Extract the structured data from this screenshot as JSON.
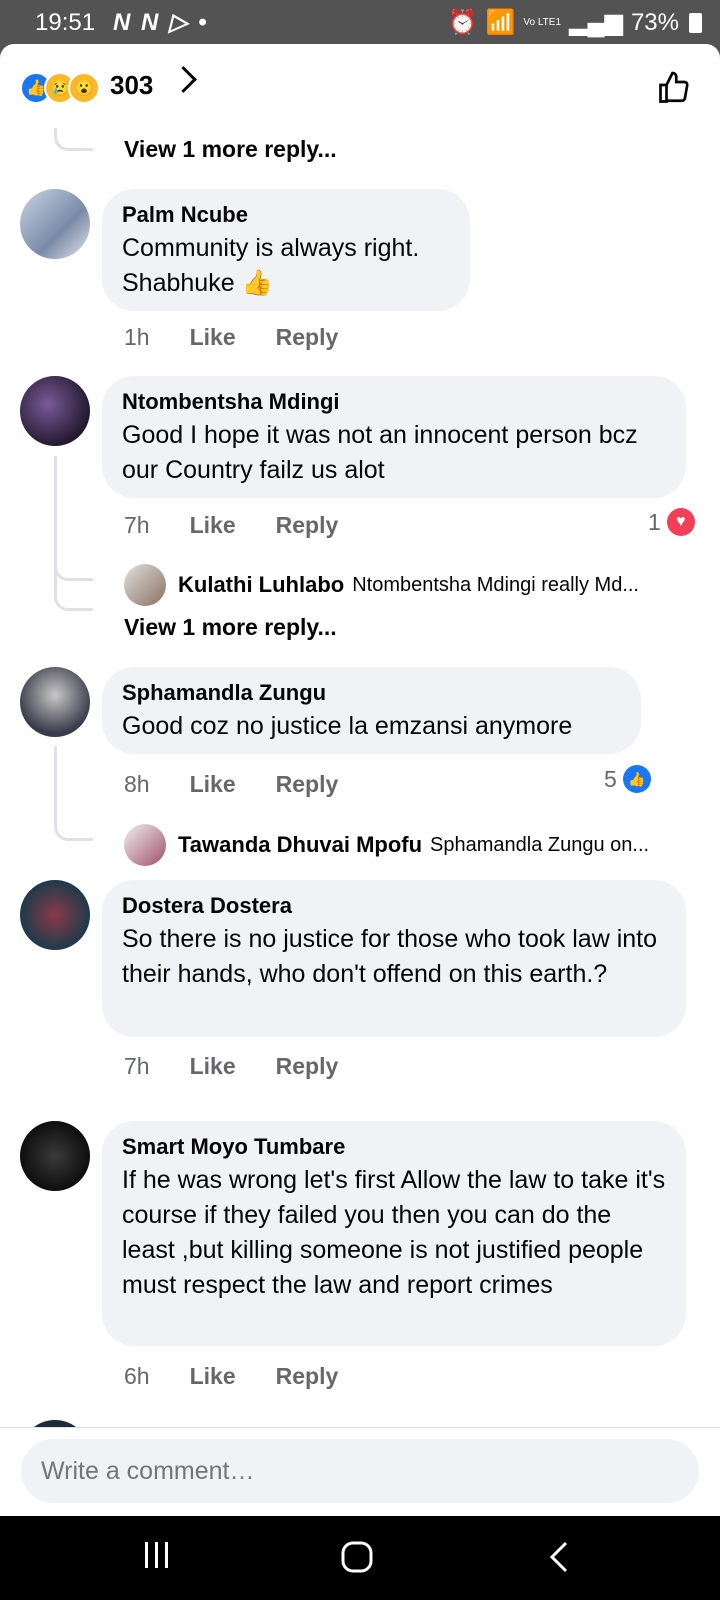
{
  "status": {
    "time": "19:51",
    "battery": "73%",
    "carrier": "Vo LTE1"
  },
  "header": {
    "count": "303",
    "reactions": [
      "like",
      "sad",
      "wow"
    ]
  },
  "comments": [
    {
      "top_view_more": "View 1 more reply..."
    },
    {
      "author": "Palm Ncube",
      "text": "Community is always right. Shabhuke 👍",
      "time": "1h",
      "like": "Like",
      "reply": "Reply"
    },
    {
      "author": "Ntombentsha Mdingi",
      "text": "Good I hope it was not an innocent person bcz our Country failz us alot",
      "time": "7h",
      "like": "Like",
      "reply": "Reply",
      "reaction_count": "1",
      "reply_preview": {
        "name": "Kulathi Luhlabo",
        "text": "Ntombentsha Mdingi really Md..."
      },
      "view_more": "View 1 more reply..."
    },
    {
      "author": "Sphamandla Zungu",
      "text": "Good coz no justice la emzansi anymore",
      "time": "8h",
      "like": "Like",
      "reply": "Reply",
      "reaction_count": "5",
      "reply_preview": {
        "name": "Tawanda Dhuvai Mpofu",
        "text": "Sphamandla Zungu on..."
      }
    },
    {
      "author": "Dostera Dostera",
      "text": "So there is no justice for those who took law into their hands, who don't offend on this earth.?",
      "time": "7h",
      "like": "Like",
      "reply": "Reply"
    },
    {
      "author": "Smart Moyo Tumbare",
      "text": "If he was wrong let's first Allow the law to take it's course if they failed you then you can do the least ,but killing someone is not justified people must respect the law and report crimes",
      "time": "6h",
      "like": "Like",
      "reply": "Reply"
    }
  ],
  "composer": {
    "placeholder": "Write a comment…"
  }
}
